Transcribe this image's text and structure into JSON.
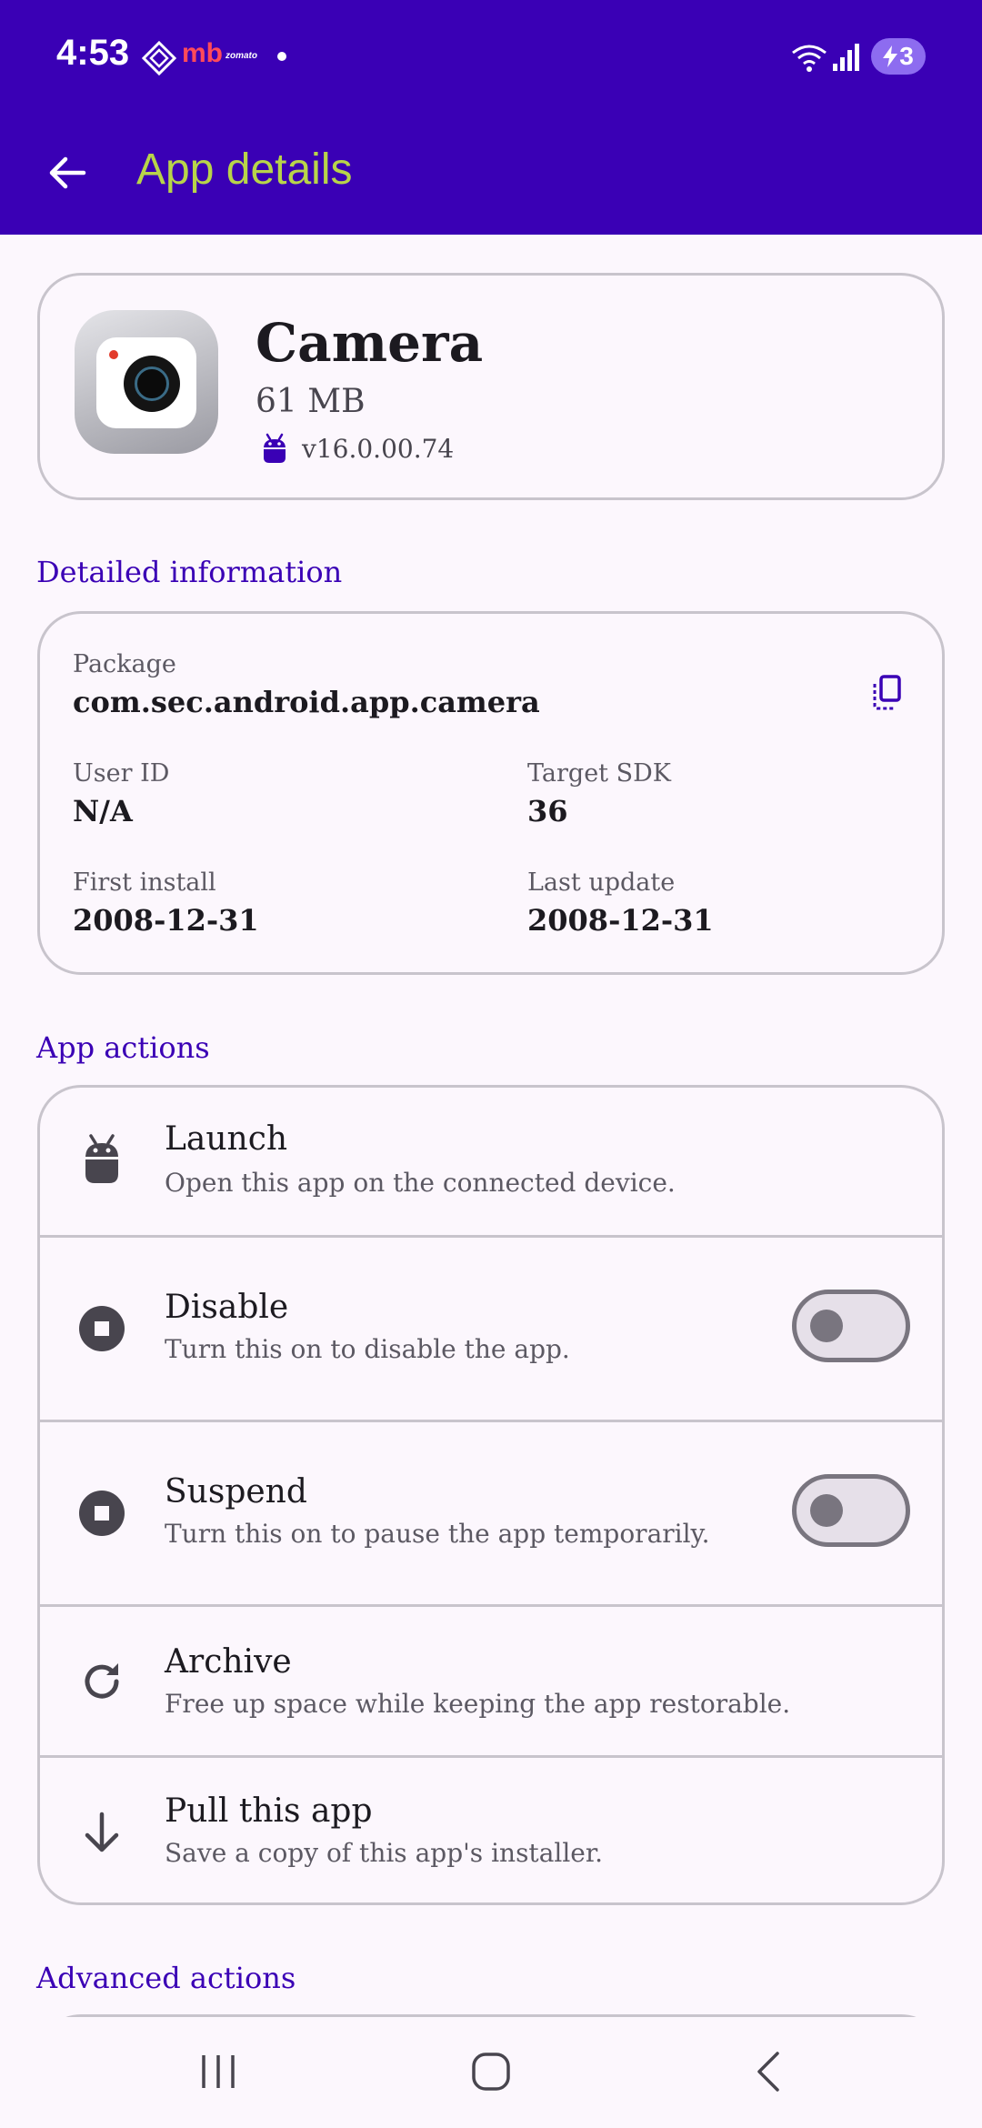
{
  "status": {
    "time": "4:53",
    "notif_mb": "mb",
    "notif_zomato": "zomato",
    "battery": "3"
  },
  "appbar": {
    "title": "App details"
  },
  "app": {
    "name": "Camera",
    "size": "61 MB",
    "version": "v16.0.00.74"
  },
  "details": {
    "section_title": "Detailed information",
    "package_label": "Package",
    "package_value": "com.sec.android.app.camera",
    "user_id_label": "User ID",
    "user_id_value": "N/A",
    "target_sdk_label": "Target SDK",
    "target_sdk_value": "36",
    "first_install_label": "First install",
    "first_install_value": "2008-12-31",
    "last_update_label": "Last update",
    "last_update_value": "2008-12-31"
  },
  "actions": {
    "section_title": "App actions",
    "items": [
      {
        "title": "Launch",
        "desc": "Open this app on the connected device."
      },
      {
        "title": "Disable",
        "desc": "Turn this on to disable the app.",
        "toggle": false
      },
      {
        "title": "Suspend",
        "desc": "Turn this on to pause the app temporarily.",
        "toggle": false
      },
      {
        "title": "Archive",
        "desc": "Free up space while keeping the app restorable."
      },
      {
        "title": "Pull this app",
        "desc": "Save a copy of this app's installer."
      }
    ]
  },
  "advanced": {
    "section_title": "Advanced actions"
  },
  "colors": {
    "primary": "#3a00b5",
    "appbar_title": "#b8d44a",
    "background": "#fcf7fd",
    "outline": "#c8c4cc"
  }
}
